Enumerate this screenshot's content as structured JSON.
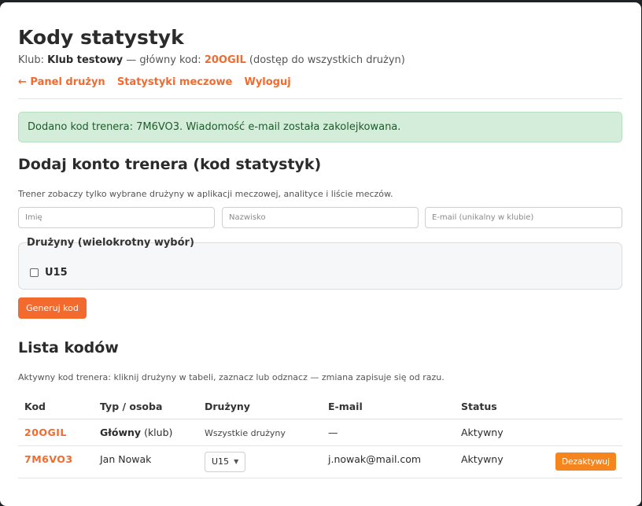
{
  "page": {
    "title": "Kody statystyk",
    "club_prefix": "Klub: ",
    "club_name": "Klub testowy",
    "main_code_prefix": " — główny kod: ",
    "main_code": "20OGIL",
    "main_code_suffix": " (dostęp do wszystkich drużyn)"
  },
  "nav": {
    "back": "← Panel drużyn",
    "match_stats": "Statystyki meczowe",
    "logout": "Wyloguj"
  },
  "alert": {
    "text": "Dodano kod trenera: 7M6VO3. Wiadomość e-mail została zakolejkowana."
  },
  "add_form": {
    "heading": "Dodaj konto trenera (kod statystyk)",
    "hint": "Trener zobaczy tylko wybrane drużyny w aplikacji meczowej, analityce i liście meczów.",
    "first_name_placeholder": "Imię",
    "last_name_placeholder": "Nazwisko",
    "email_placeholder": "E-mail (unikalny w klubie)",
    "teams_legend": "Drużyny (wielokrotny wybór)",
    "teams": [
      {
        "label": "U15",
        "checked": false
      }
    ],
    "submit_label": "Generuj kod"
  },
  "codes": {
    "heading": "Lista kodów",
    "hint": "Aktywny kod trenera: kliknij drużyny w tabeli, zaznacz lub odznacz — zmiana zapisuje się od razu.",
    "columns": [
      "Kod",
      "Typ / osoba",
      "Drużyny",
      "E-mail",
      "Status",
      ""
    ],
    "rows": [
      {
        "code": "20OGIL",
        "type_bold": "Główny",
        "type_rest": " (klub)",
        "teams": "Wszystkie drużyny",
        "email": "—",
        "status": "Aktywny"
      },
      {
        "code": "7M6VO3",
        "person": "Jan Nowak",
        "teams_selected": "U15",
        "email": "j.nowak@mail.com",
        "status": "Aktywny",
        "action_label": "Dezaktywuj"
      }
    ]
  },
  "colors": {
    "accent": "#f26a2e",
    "success_bg": "#d4edda",
    "deactivate_button": "#f5861f"
  }
}
